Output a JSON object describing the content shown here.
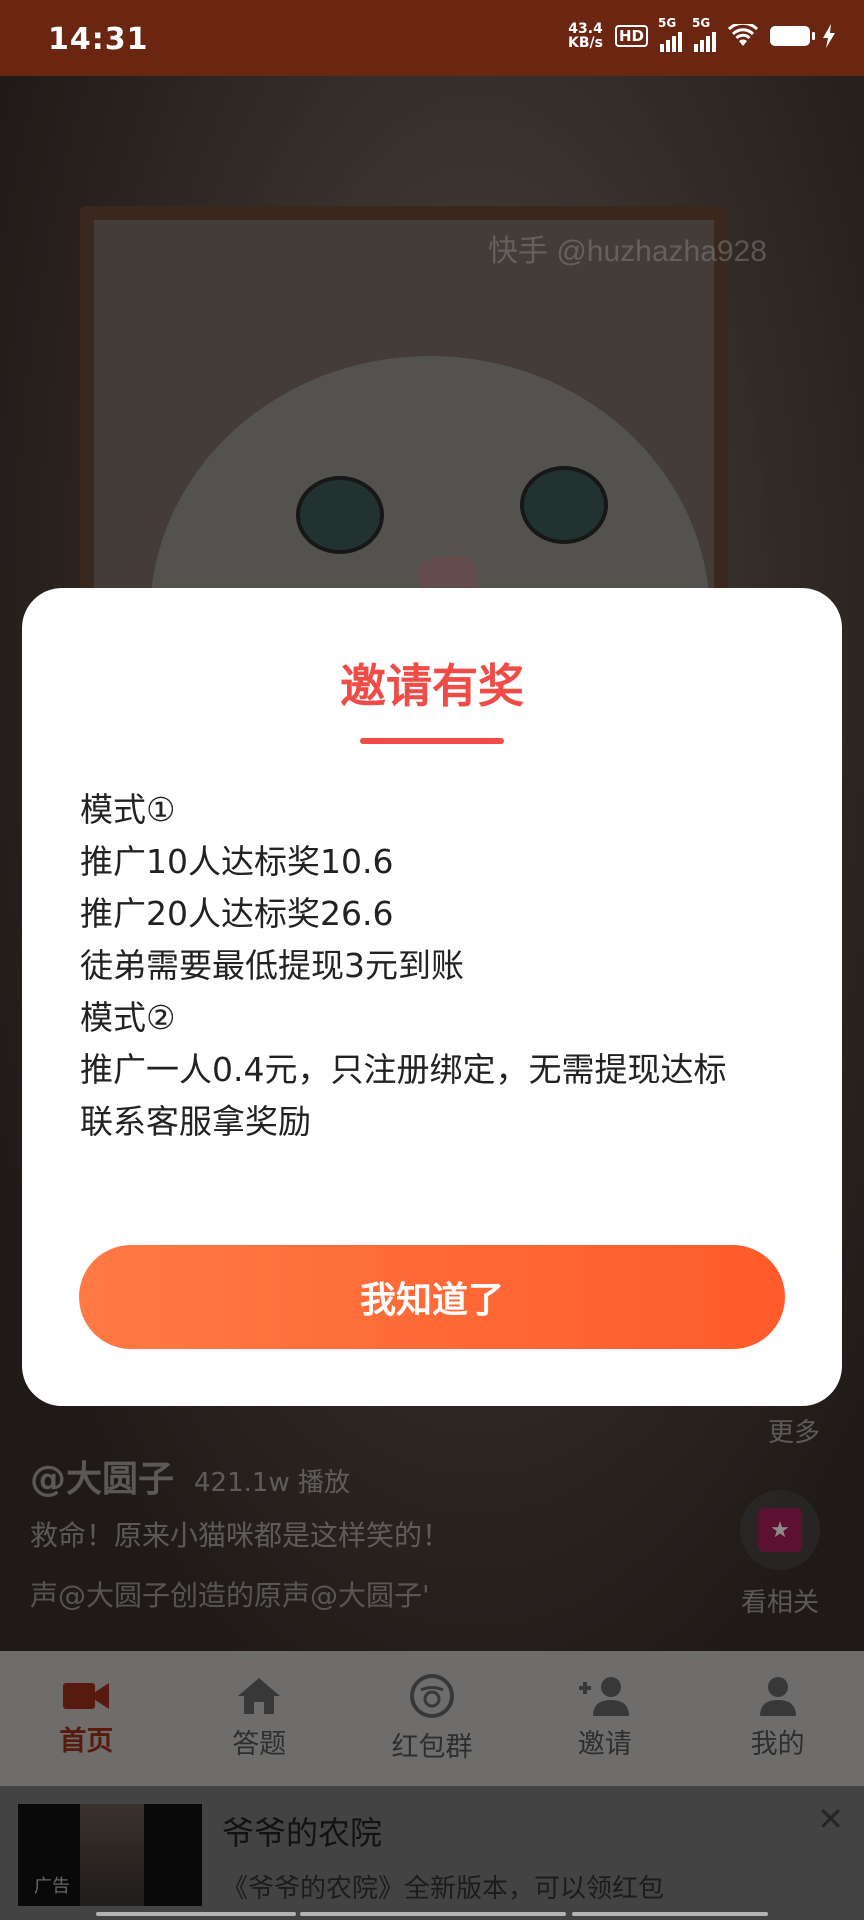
{
  "status_bar": {
    "time": "14:31",
    "net_speed_top": "43.4",
    "net_speed_unit": "KB/s",
    "hd_label": "HD",
    "sim1_label": "5G",
    "sim2_label": "5G"
  },
  "video": {
    "watermark": "快手 @huzhazha928",
    "author": "@大圆子",
    "plays": "421.1w 播放",
    "caption": "救命！原来小猫咪都是这样笑的！",
    "music": "声@大圆子创造的原声@大圆子'",
    "side_more": "更多",
    "side_related": "看相关"
  },
  "modal": {
    "title": "邀请有奖",
    "lines": [
      "模式①",
      "推广10人达标奖10.6",
      "推广20人达标奖26.6",
      "徒弟需要最低提现3元到账",
      "模式②",
      "推广一人0.4元，只注册绑定，无需提现达标",
      "联系客服拿奖励"
    ],
    "button_label": "我知道了"
  },
  "tabbar": {
    "tabs": [
      {
        "label": "首页",
        "icon": "video-camera-icon",
        "active": true
      },
      {
        "label": "答题",
        "icon": "home-icon",
        "active": false
      },
      {
        "label": "红包群",
        "icon": "red-envelope-icon",
        "active": false
      },
      {
        "label": "邀请",
        "icon": "add-user-icon",
        "active": false
      },
      {
        "label": "我的",
        "icon": "person-icon",
        "active": false
      }
    ]
  },
  "ad": {
    "thumb_tag": "广告",
    "title": "爷爷的农院",
    "desc": "《爷爷的农院》全新版本，可以领红包"
  },
  "colors": {
    "accent": "#ef4c48",
    "button_start": "#ff7a45",
    "button_end": "#ff5a2a",
    "tab_active": "#a0301a"
  }
}
